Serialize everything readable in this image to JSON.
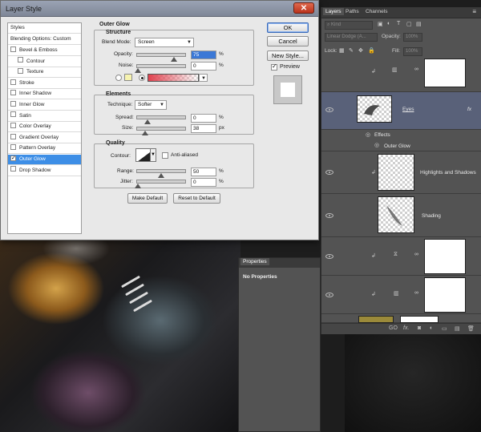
{
  "dialog": {
    "title": "Layer Style",
    "close_glyph": "✕",
    "styles_list": {
      "header": "Styles",
      "blending": "Blending Options: Custom",
      "items": [
        {
          "label": "Bevel & Emboss",
          "checked": false,
          "sub": false
        },
        {
          "label": "Contour",
          "checked": false,
          "sub": true
        },
        {
          "label": "Texture",
          "checked": false,
          "sub": true
        },
        {
          "label": "Stroke",
          "checked": false,
          "sub": false
        },
        {
          "label": "Inner Shadow",
          "checked": false,
          "sub": false
        },
        {
          "label": "Inner Glow",
          "checked": false,
          "sub": false
        },
        {
          "label": "Satin",
          "checked": false,
          "sub": false
        },
        {
          "label": "Color Overlay",
          "checked": false,
          "sub": false
        },
        {
          "label": "Gradient Overlay",
          "checked": false,
          "sub": false
        },
        {
          "label": "Pattern Overlay",
          "checked": false,
          "sub": false
        },
        {
          "label": "Outer Glow",
          "checked": true,
          "sub": false,
          "selected": true
        },
        {
          "label": "Drop Shadow",
          "checked": false,
          "sub": false
        }
      ]
    },
    "outer_glow": {
      "title": "Outer Glow",
      "structure": {
        "title": "Structure",
        "blend_mode_label": "Blend Mode:",
        "blend_mode_value": "Screen",
        "opacity_label": "Opacity:",
        "opacity_value": "75",
        "noise_label": "Noise:",
        "noise_value": "0",
        "percent": "%"
      },
      "elements": {
        "title": "Elements",
        "technique_label": "Technique:",
        "technique_value": "Softer",
        "spread_label": "Spread:",
        "spread_value": "0",
        "size_label": "Size:",
        "size_value": "38",
        "percent": "%",
        "px": "px"
      },
      "quality": {
        "title": "Quality",
        "contour_label": "Contour:",
        "anti_aliased_label": "Anti-aliased",
        "range_label": "Range:",
        "range_value": "50",
        "jitter_label": "Jitter:",
        "jitter_value": "0",
        "percent": "%"
      },
      "make_default": "Make Default",
      "reset_default": "Reset to Default"
    },
    "buttons": {
      "ok": "OK",
      "cancel": "Cancel",
      "new_style": "New Style...",
      "preview": "Preview"
    },
    "colors": {
      "glow_color": "#f6f3b0",
      "gradient_color": "#e0424f",
      "selection": "#3d8ee6"
    }
  },
  "layers_panel": {
    "tabs": [
      "Layers",
      "Paths",
      "Channels"
    ],
    "filter_kind": "Kind",
    "blend_mode": "Linear Dodge (A...",
    "opacity_label": "Opacity:",
    "opacity_value": "100%",
    "lock_label": "Lock:",
    "fill_label": "Fill:",
    "fill_value": "100%",
    "layers": [
      {
        "name": "",
        "thumb": "white"
      },
      {
        "name": "Eyes",
        "thumb": "eye",
        "selected": true,
        "fx": "fx"
      },
      {
        "name": "Highlights and Shadows",
        "thumb": "trans"
      },
      {
        "name": "Shading",
        "thumb": "trans"
      },
      {
        "name": "",
        "thumb": "white"
      },
      {
        "name": "",
        "thumb": "white"
      }
    ],
    "effects_label": "Effects",
    "outer_glow_effect": "Outer Glow",
    "bottom_icons": [
      "GO",
      "fx.",
      "◙",
      "◐",
      "▭",
      "▤",
      "🗑"
    ]
  },
  "properties_panel": {
    "tab": "Properties",
    "text": "No Properties"
  }
}
